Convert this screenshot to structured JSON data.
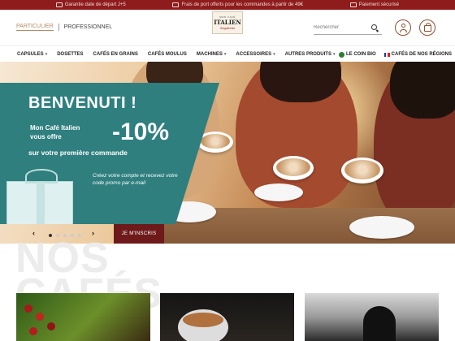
{
  "topbar": {
    "items": [
      {
        "icon": "calendar-icon",
        "text": "Garantie date de départ J+5"
      },
      {
        "icon": "truck-icon",
        "text": "Frais de port offerts pour les commandes à partir de 49€"
      },
      {
        "icon": "lock-card-icon",
        "text": "Paiement sécurisé"
      }
    ]
  },
  "header": {
    "segment_particulier": "PARTICULIER",
    "segment_professionnel": "PROFESSIONNEL",
    "logo_line1": "MON CAFÉ",
    "logo_line2": "ITALIEN",
    "logo_line3": "Segafredo",
    "search_placeholder": "Rechercher"
  },
  "nav": {
    "items": [
      {
        "label": "CAPSULES",
        "has_caret": true
      },
      {
        "label": "DOSETTES",
        "has_caret": false
      },
      {
        "label": "CAFÉS EN GRAINS",
        "has_caret": false
      },
      {
        "label": "CAFÉS MOULUS",
        "has_caret": false
      },
      {
        "label": "MACHINES",
        "has_caret": true
      },
      {
        "label": "ACCESSOIRES",
        "has_caret": true
      },
      {
        "label": "AUTRES PRODUITS",
        "has_caret": true
      }
    ],
    "coin_bio": "LE COIN BIO",
    "cafes_regions": "CAFÉS DE NOS RÉGIONS"
  },
  "hero": {
    "title": "BENVENUTI !",
    "line1": "Mon Café Italien",
    "line2": "vous offre",
    "discount": "-10%",
    "line3": "sur votre première commande",
    "cta_text": "Créez votre compte et recevez votre code promo par e-mail"
  },
  "carousel": {
    "prev": "‹",
    "next": "›",
    "active_index": 0,
    "dot_count": 5,
    "signup_label": "JE M'INSCRIS"
  },
  "section": {
    "title_line1": "NOS",
    "title_line2": "CAFÉS"
  },
  "colors": {
    "topbar": "#8e1c1c",
    "accent": "#b68a63",
    "promo": "#2f7f7f",
    "signup": "#6e1a1a"
  }
}
